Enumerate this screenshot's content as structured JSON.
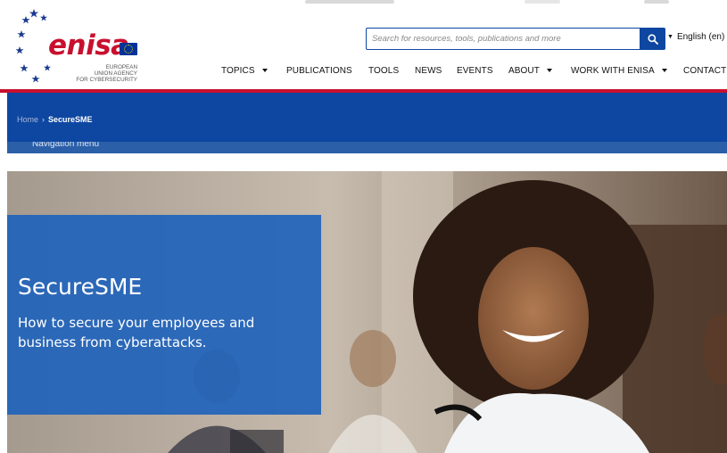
{
  "header": {
    "logo": {
      "wordmark": "enisa",
      "agency_lines": [
        "EUROPEAN",
        "UNION AGENCY",
        "FOR CYBERSECURITY"
      ]
    },
    "search": {
      "placeholder": "Search for resources, tools, publications and more",
      "button_icon": "search-icon"
    },
    "language": {
      "label": "English (en)",
      "icon": "caret-down-icon"
    },
    "nav": [
      {
        "label": "TOPICS",
        "has_dropdown": true
      },
      {
        "label": "PUBLICATIONS",
        "has_dropdown": false
      },
      {
        "label": "TOOLS",
        "has_dropdown": false
      },
      {
        "label": "NEWS",
        "has_dropdown": false
      },
      {
        "label": "EVENTS",
        "has_dropdown": false
      },
      {
        "label": "ABOUT",
        "has_dropdown": true
      },
      {
        "label": "WORK WITH ENISA",
        "has_dropdown": true
      },
      {
        "label": "CONTACT",
        "has_dropdown": false
      }
    ]
  },
  "breadcrumb": {
    "home": "Home",
    "separator": "›",
    "current": "SecureSME"
  },
  "subnav": {
    "label": "Navigation menu"
  },
  "hero": {
    "title": "SecureSME",
    "subtitle": "How to secure your employees and business from cyberattacks."
  },
  "colors": {
    "brand_red": "#c8102e",
    "brand_blue": "#0e47a1",
    "hero_box": "#2163bb",
    "text": "#111111"
  }
}
